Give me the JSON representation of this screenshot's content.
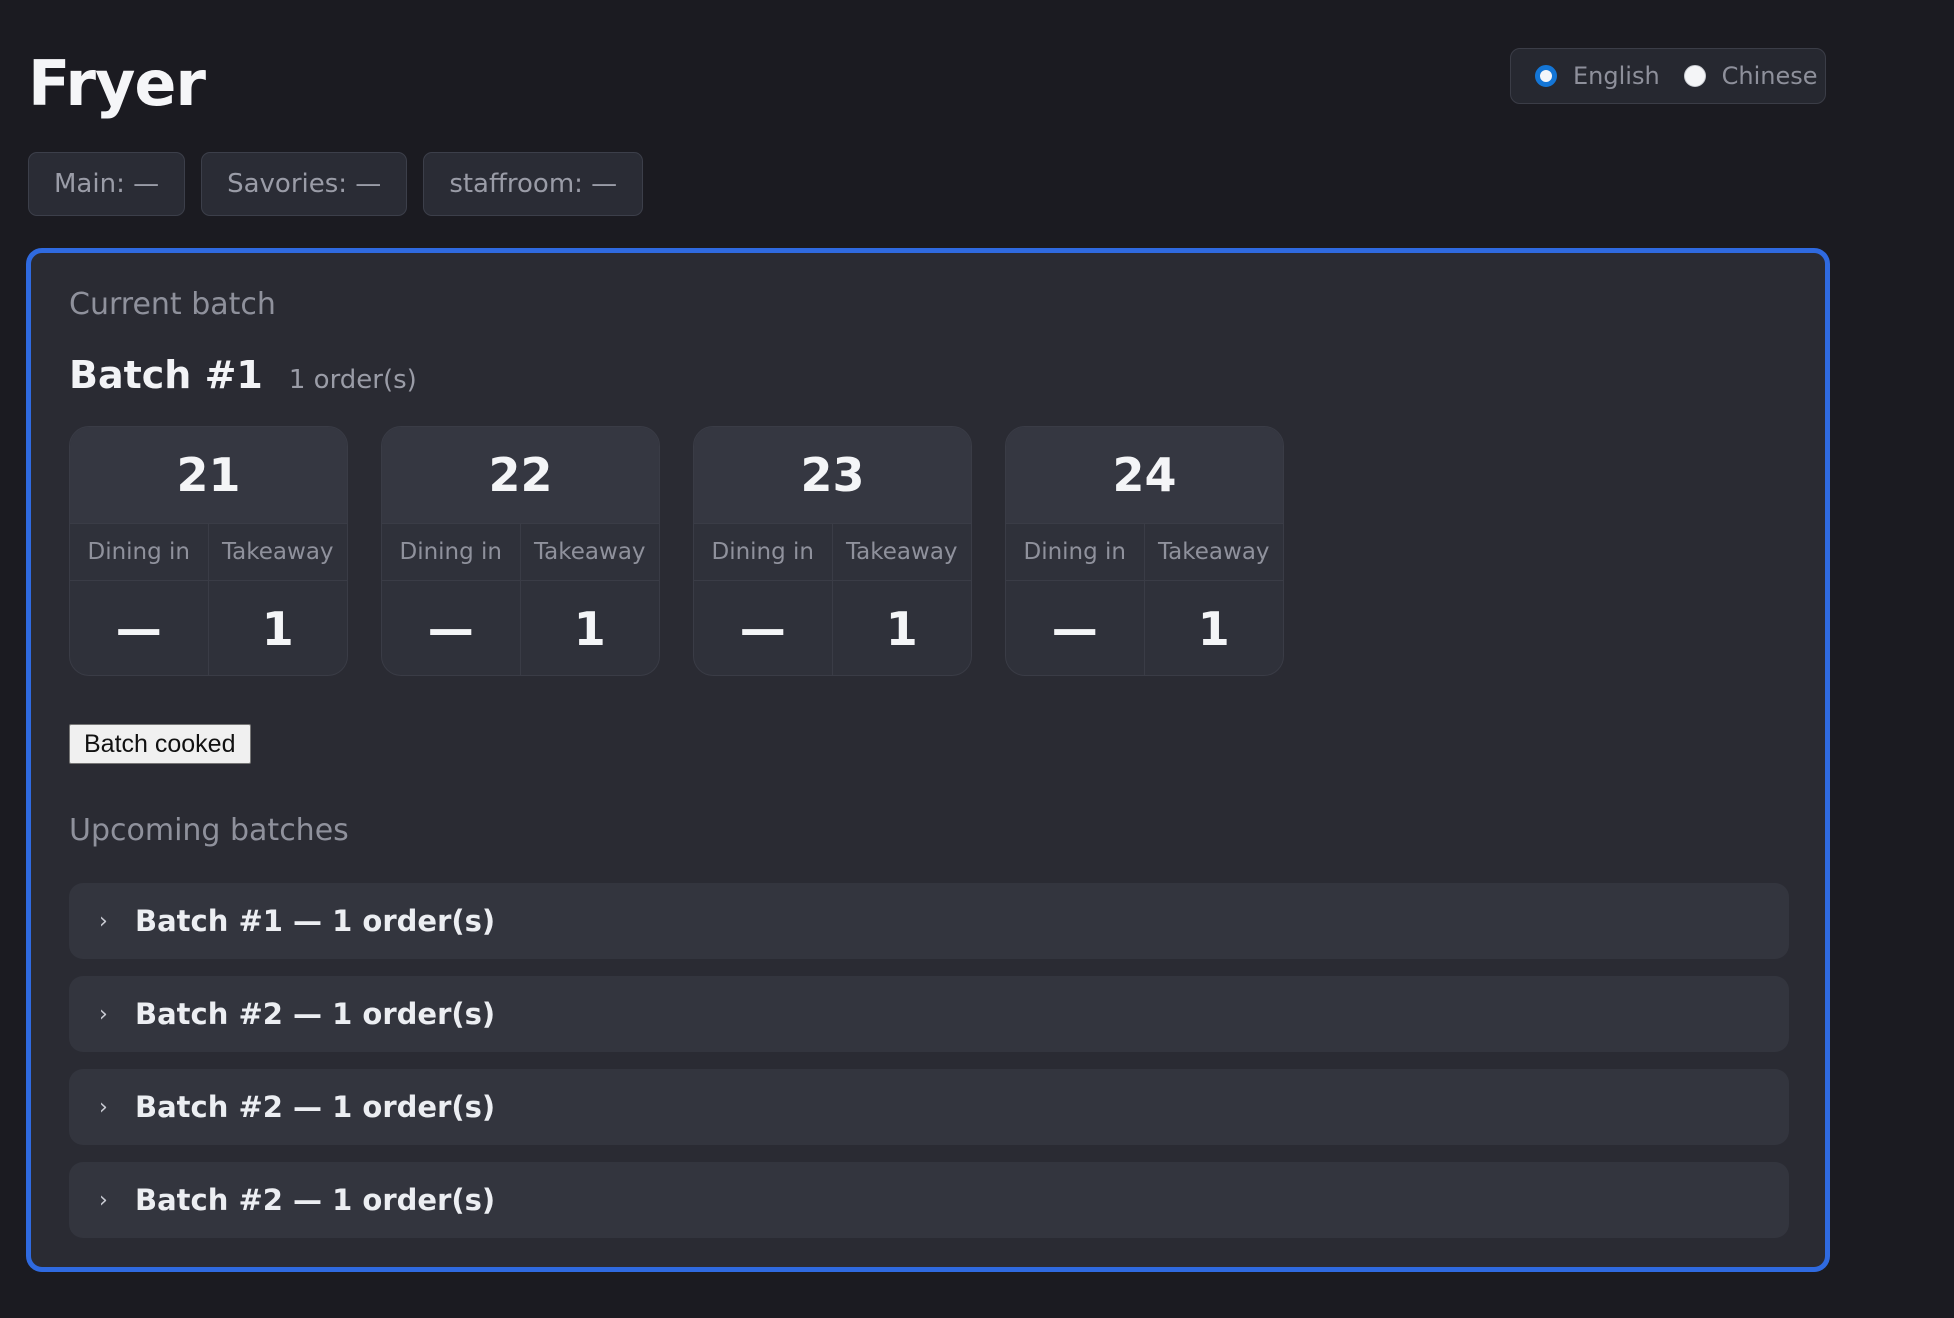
{
  "page": {
    "title": "Fryer"
  },
  "language": {
    "options": [
      {
        "label": "English",
        "selected": true
      },
      {
        "label": "Chinese",
        "selected": false
      }
    ]
  },
  "stations": [
    {
      "label": "Main: —"
    },
    {
      "label": "Savories: —"
    },
    {
      "label": "staffroom: —"
    }
  ],
  "current": {
    "section_label": "Current batch",
    "batch_title": "Batch #1",
    "order_count": "1 order(s)",
    "dining_header": "Dining in",
    "takeaway_header": "Takeaway",
    "orders": [
      {
        "number": "21",
        "dining": "—",
        "takeaway": "1"
      },
      {
        "number": "22",
        "dining": "—",
        "takeaway": "1"
      },
      {
        "number": "23",
        "dining": "—",
        "takeaway": "1"
      },
      {
        "number": "24",
        "dining": "—",
        "takeaway": "1"
      }
    ],
    "cooked_button": "Batch cooked"
  },
  "upcoming": {
    "section_label": "Upcoming batches",
    "chevron": "›",
    "items": [
      {
        "label": "Batch #1 — 1 order(s)"
      },
      {
        "label": "Batch #2 — 1 order(s)"
      },
      {
        "label": "Batch #2 — 1 order(s)"
      },
      {
        "label": "Batch #2 — 1 order(s)"
      }
    ]
  },
  "colors": {
    "accent": "#2f6ae0",
    "radio_selected": "#1476d6",
    "background": "#1b1b21",
    "panel": "#2a2b33"
  }
}
